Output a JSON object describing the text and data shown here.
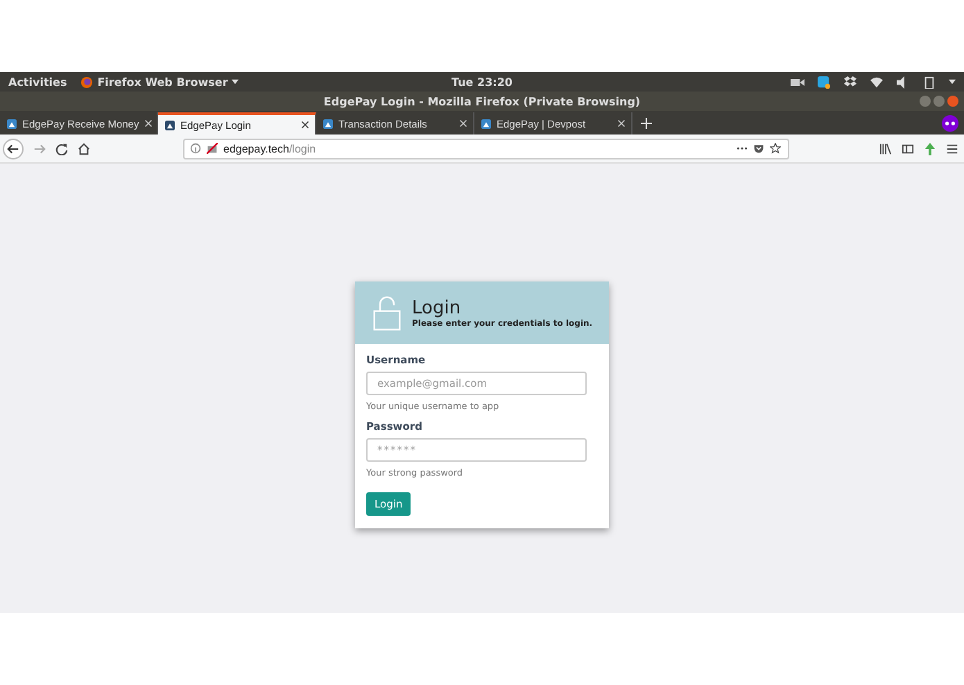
{
  "top_bar": {
    "activities": "Activities",
    "app_menu": "Firefox Web Browser",
    "clock": "Tue 23:20"
  },
  "window": {
    "title": "EdgePay Login - Mozilla Firefox (Private Browsing)"
  },
  "tabs": [
    {
      "label": "EdgePay Receive Money",
      "selected": false
    },
    {
      "label": "EdgePay Login",
      "selected": true
    },
    {
      "label": "Transaction Details",
      "selected": false
    },
    {
      "label": "EdgePay | Devpost",
      "selected": false
    }
  ],
  "address_bar": {
    "host": "edgepay.tech",
    "path": "/login"
  },
  "login_card": {
    "title": "Login",
    "subtitle": "Please enter your credentials to login.",
    "fields": [
      {
        "label": "Username",
        "placeholder": "example@gmail.com",
        "help": "Your unique username to app",
        "kind": "text"
      },
      {
        "label": "Password",
        "placeholder": "******",
        "help": "Your strong password",
        "kind": "password"
      }
    ],
    "button": "Login"
  }
}
